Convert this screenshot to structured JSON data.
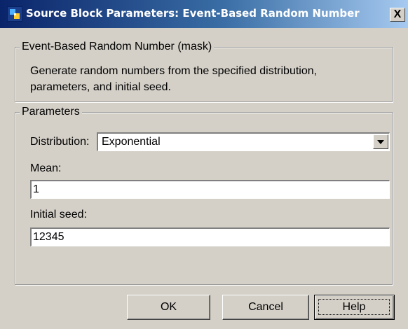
{
  "window": {
    "title": "Source Block Parameters: Event-Based Random Number",
    "close_label": "X"
  },
  "mask_group": {
    "label": "Event-Based Random Number (mask)",
    "description_line1": "Generate random numbers from the specified distribution,",
    "description_line2": "parameters, and initial seed."
  },
  "parameters_group": {
    "label": "Parameters",
    "distribution_label": "Distribution:",
    "distribution_value": "Exponential",
    "mean_label": "Mean:",
    "mean_value": "1",
    "seed_label": "Initial seed:",
    "seed_value": "12345"
  },
  "buttons": {
    "ok": "OK",
    "cancel": "Cancel",
    "help": "Help"
  },
  "colors": {
    "titlebar_start": "#0a246a",
    "titlebar_end": "#a6caf0",
    "dialog_background": "#d4d0c8"
  },
  "icons": {
    "app": "simulink-block-icon",
    "dropdown": "chevron-down-icon"
  }
}
